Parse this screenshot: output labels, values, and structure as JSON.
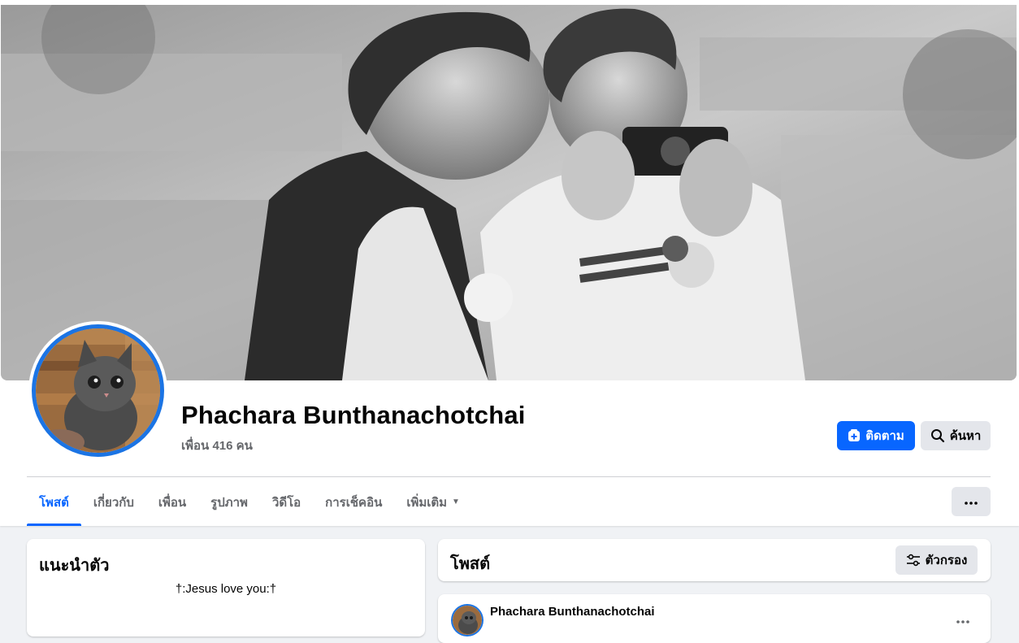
{
  "profile": {
    "name": "Phachara Bunthanachotchai",
    "friends_text": "เพื่อน 416 คน",
    "cover_photo": "black-and-white photo of two people, one holding a camera",
    "avatar_photo": "kitten"
  },
  "actions": {
    "follow_label": "ติดตาม",
    "follow_icon": "follow-plus-icon",
    "search_label": "ค้นหา",
    "search_icon": "search-icon",
    "more_icon": "ellipsis-icon"
  },
  "tabs": [
    {
      "label": "โพสต์",
      "active": true
    },
    {
      "label": "เกี่ยวกับ",
      "active": false
    },
    {
      "label": "เพื่อน",
      "active": false
    },
    {
      "label": "รูปภาพ",
      "active": false
    },
    {
      "label": "วิดีโอ",
      "active": false
    },
    {
      "label": "การเช็คอิน",
      "active": false
    },
    {
      "label": "เพิ่มเติม",
      "active": false,
      "dropdown": true
    }
  ],
  "intro": {
    "title": "แนะนำตัว",
    "bio": "†:Jesus love you:†"
  },
  "posts": {
    "title": "โพสต์",
    "filter_label": "ตัวกรอง",
    "filter_icon": "filter-sliders-icon",
    "first_post_author": "Phachara Bunthanachotchai"
  },
  "colors": {
    "accent": "#0866ff",
    "page_background": "#f0f2f5",
    "secondary_button": "#e4e6eb",
    "secondary_text": "#65676b"
  }
}
